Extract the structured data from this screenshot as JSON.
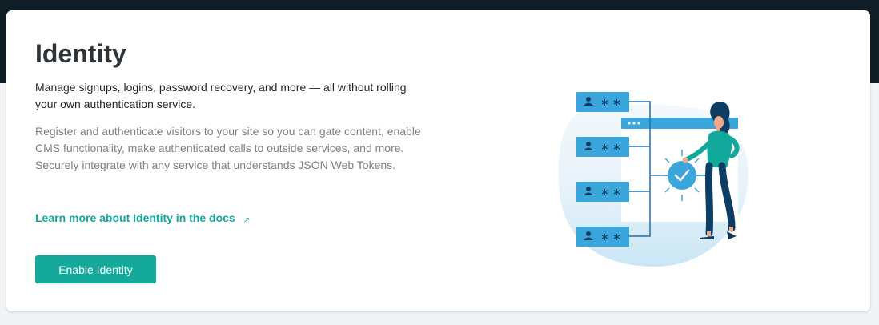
{
  "card": {
    "title": "Identity",
    "lead": "Manage signups, logins, password recovery, and more — all without rolling your own authentication service.",
    "description": "Register and authenticate visitors to your site so you can gate content, enable CMS functionality, make authenticated calls to outside services, and more. Securely integrate with any service that understands JSON Web Tokens.",
    "docs_link": "Learn more about Identity in the docs",
    "docs_link_icon": "external-arrow-icon",
    "enable_button": "Enable Identity"
  },
  "colors": {
    "topbar": "#0f1e26",
    "accent": "#14a99b",
    "server_blue": "#3aa6dc"
  }
}
